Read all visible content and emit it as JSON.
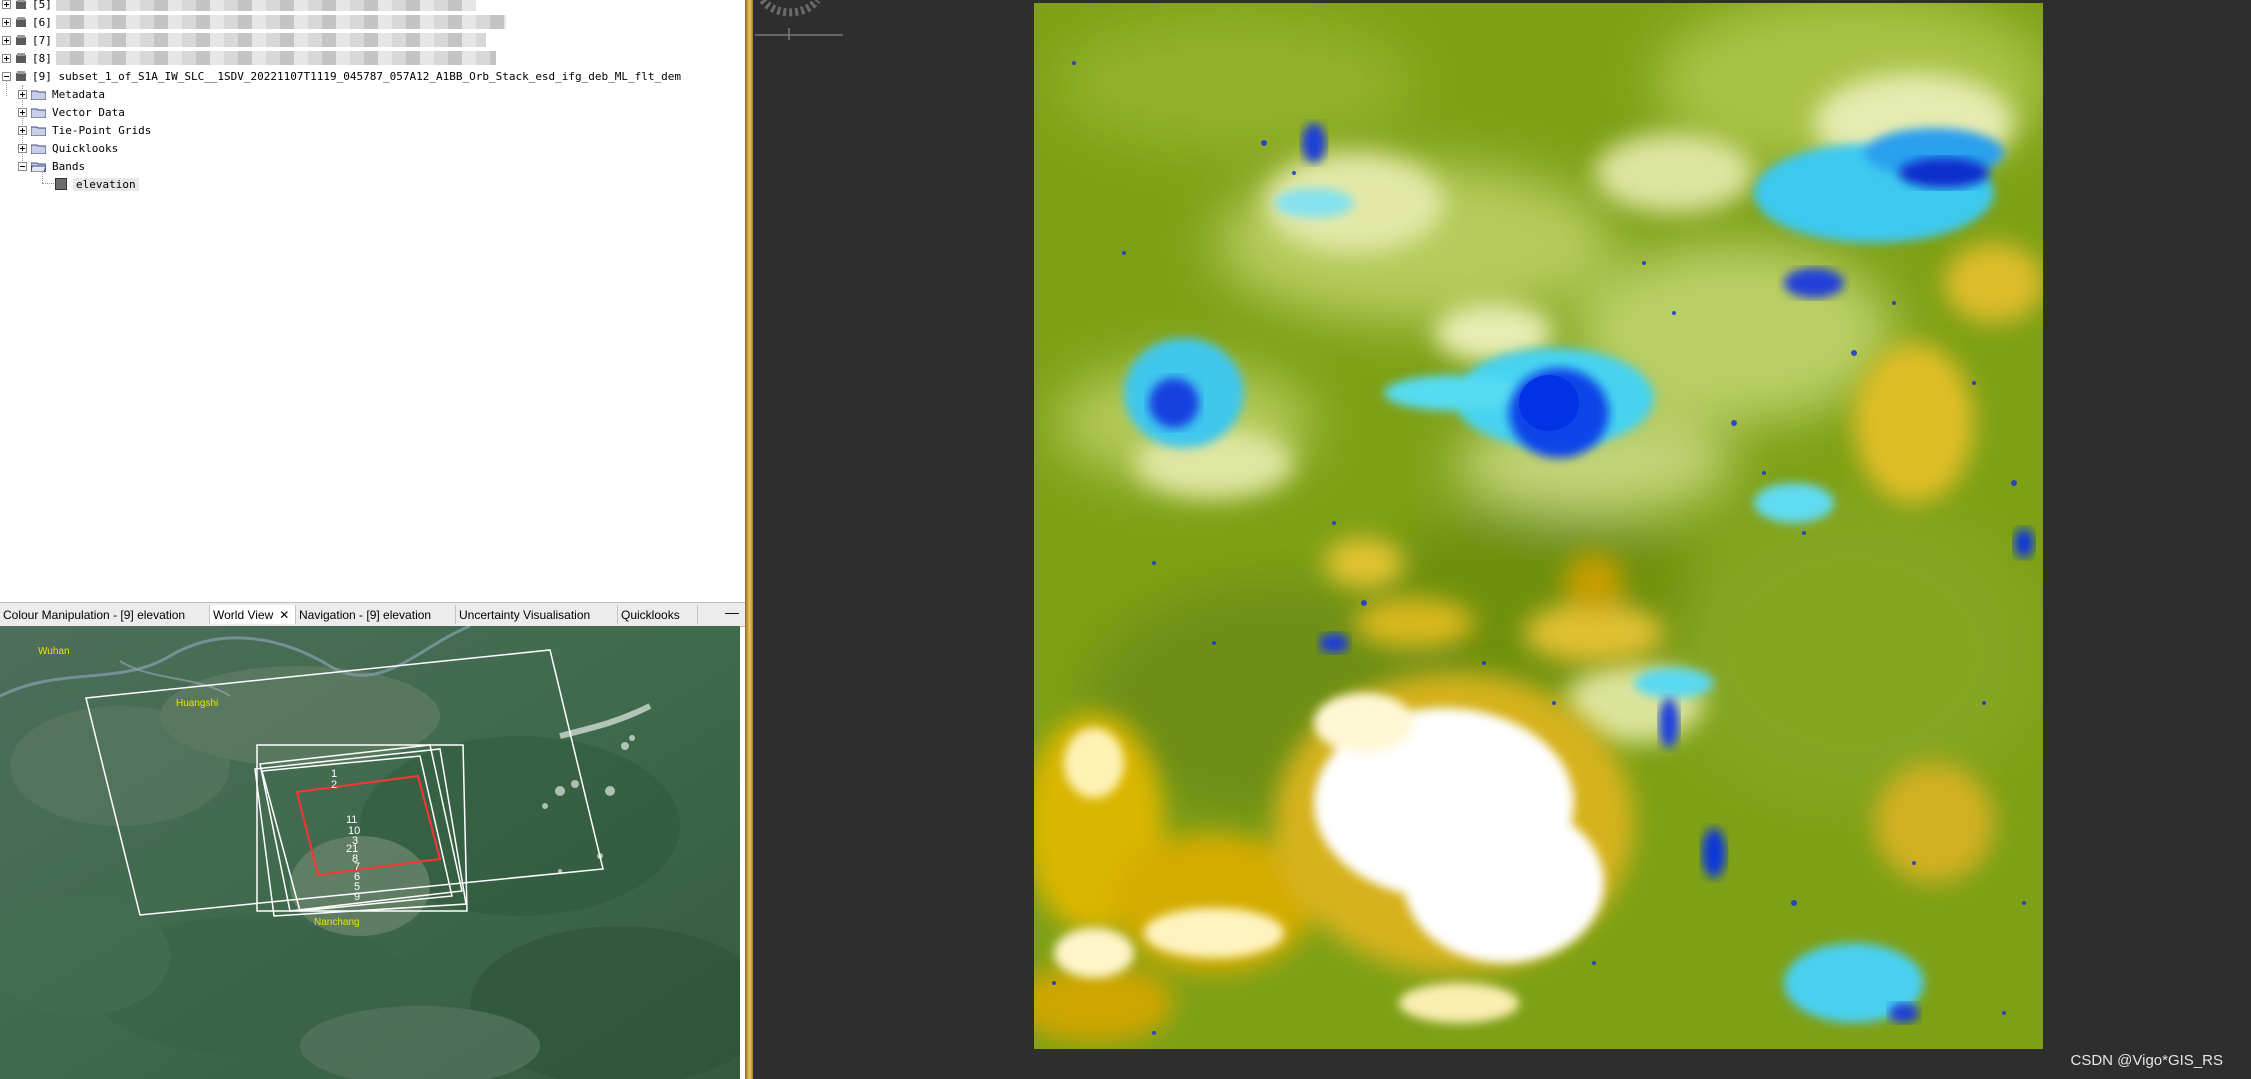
{
  "product_tree": {
    "products": [
      {
        "label": "[5]"
      },
      {
        "label": "[6]"
      },
      {
        "label": "[7]"
      },
      {
        "label": "[8]"
      },
      {
        "label": "[9] subset_1_of_S1A_IW_SLC__1SDV_20221107T1119_045787_057A12_A1BB_Orb_Stack_esd_ifg_deb_ML_flt_dem"
      }
    ],
    "folders": [
      "Metadata",
      "Vector Data",
      "Tie-Point Grids",
      "Quicklooks",
      "Bands"
    ],
    "band": "elevation"
  },
  "tabs": [
    {
      "label": "Colour Manipulation - [9] elevation",
      "active": false
    },
    {
      "label": "World View",
      "active": true
    },
    {
      "label": "Navigation - [9] elevation",
      "active": false
    },
    {
      "label": "Uncertainty Visualisation",
      "active": false
    },
    {
      "label": "Quicklooks",
      "active": false
    }
  ],
  "tab_close": "✕",
  "minimize": "—",
  "world_view": {
    "places": [
      "Wuhan",
      "Huangshi",
      "Nanchang"
    ],
    "footprint_numbers": [
      "1",
      "2",
      "11",
      "10",
      "3",
      "21",
      "8",
      "7",
      "6",
      "5",
      "9"
    ]
  },
  "watermark": "CSDN @Vigo*GIS_RS",
  "colors": {
    "selection_outline": "#ff3333",
    "footprint": "#ffffff",
    "divider": "#d9a845",
    "viewer_bg": "#2e2e2e"
  }
}
